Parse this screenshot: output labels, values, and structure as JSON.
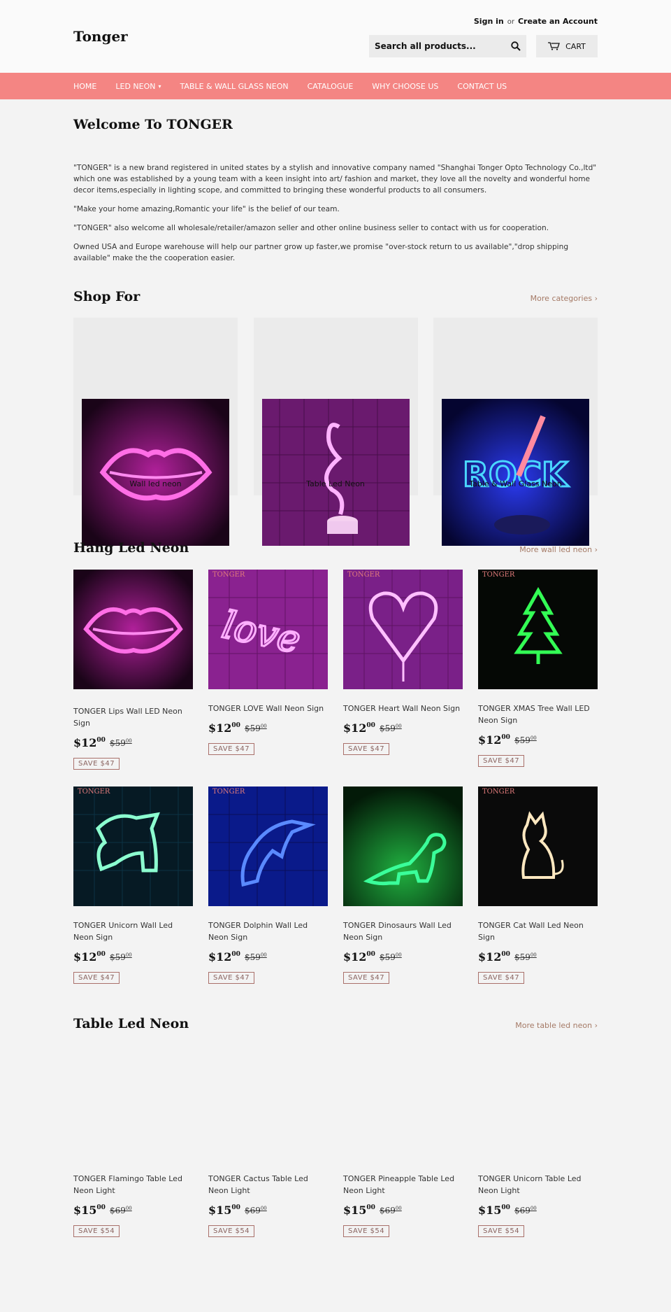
{
  "header": {
    "logo": "Tonger",
    "sign_in": "Sign in",
    "or": "or",
    "create_account": "Create an Account",
    "search_placeholder": "Search all products...",
    "cart_label": "CART"
  },
  "nav": {
    "items": [
      "HOME",
      "LED NEON",
      "TABLE & WALL GLASS NEON",
      "CATALOGUE",
      "WHY CHOOSE US",
      "CONTACT US"
    ]
  },
  "welcome": {
    "title": "Welcome To TONGER",
    "paragraphs": [
      "\"TONGER\" is a new brand registered in united states by a stylish and innovative company named \"Shanghai Tonger Opto Technology Co.,ltd\" which one was established by a young team with a keen insight into art/ fashion and market, they love all the novelty and wonderful home decor items,especially in lighting scope, and committed to bringing these wonderful products to all consumers.",
      "\"Make your home amazing,Romantic your life\" is the belief of our team.",
      "\"TONGER\" also welcome all wholesale/retailer/amazon seller and other online business seller to contact with us for cooperation.",
      "Owned USA and Europe warehouse will help our partner grow up faster,we promise \"over-stock return to us available\",\"drop shipping available\" make the the cooperation easier."
    ]
  },
  "shop_for": {
    "title": "Shop For",
    "more": "More categories ›",
    "categories": [
      "Wall led neon",
      "Table Led Neon",
      "Table & Wall Glass Neon"
    ]
  },
  "hang": {
    "title": "Hang Led Neon",
    "more": "More wall led neon ›",
    "products": [
      {
        "title": "TONGER Lips Wall LED Neon Sign",
        "price": "$12",
        "cents": "00",
        "was": "$59",
        "was_cents": "00",
        "save": "SAVE $47",
        "brand": ""
      },
      {
        "title": "TONGER LOVE Wall Neon Sign",
        "price": "$12",
        "cents": "00",
        "was": "$59",
        "was_cents": "00",
        "save": "SAVE $47",
        "brand": "TONGER"
      },
      {
        "title": "TONGER Heart Wall Neon Sign",
        "price": "$12",
        "cents": "00",
        "was": "$59",
        "was_cents": "00",
        "save": "SAVE $47",
        "brand": "TONGER"
      },
      {
        "title": "TONGER XMAS Tree Wall LED Neon Sign",
        "price": "$12",
        "cents": "00",
        "was": "$59",
        "was_cents": "00",
        "save": "SAVE $47",
        "brand": "TONGER"
      },
      {
        "title": "TONGER Unicorn Wall Led Neon Sign",
        "price": "$12",
        "cents": "00",
        "was": "$59",
        "was_cents": "00",
        "save": "SAVE $47",
        "brand": "TONGER"
      },
      {
        "title": "TONGER Dolphin Wall Led Neon Sign",
        "price": "$12",
        "cents": "00",
        "was": "$59",
        "was_cents": "00",
        "save": "SAVE $47",
        "brand": "TONGER"
      },
      {
        "title": "TONGER Dinosaurs Wall Led Neon Sign",
        "price": "$12",
        "cents": "00",
        "was": "$59",
        "was_cents": "00",
        "save": "SAVE $47",
        "brand": ""
      },
      {
        "title": "TONGER Cat Wall Led Neon Sign",
        "price": "$12",
        "cents": "00",
        "was": "$59",
        "was_cents": "00",
        "save": "SAVE $47",
        "brand": "TONGER"
      }
    ]
  },
  "table": {
    "title": "Table Led Neon",
    "more": "More table led neon ›",
    "products": [
      {
        "title": "TONGER Flamingo Table Led Neon Light",
        "price": "$15",
        "cents": "00",
        "was": "$69",
        "was_cents": "00",
        "save": "SAVE $54"
      },
      {
        "title": "TONGER Cactus Table Led Neon Light",
        "price": "$15",
        "cents": "00",
        "was": "$69",
        "was_cents": "00",
        "save": "SAVE $54"
      },
      {
        "title": "TONGER Pineapple Table Led Neon Light",
        "price": "$15",
        "cents": "00",
        "was": "$69",
        "was_cents": "00",
        "save": "SAVE $54"
      },
      {
        "title": "TONGER Unicorn Table Led Neon Light",
        "price": "$15",
        "cents": "00",
        "was": "$69",
        "was_cents": "00",
        "save": "SAVE $54"
      }
    ]
  },
  "colors": {
    "nav_bg": "#f48583",
    "save_border": "#a9706a",
    "link": "#a57a66"
  }
}
